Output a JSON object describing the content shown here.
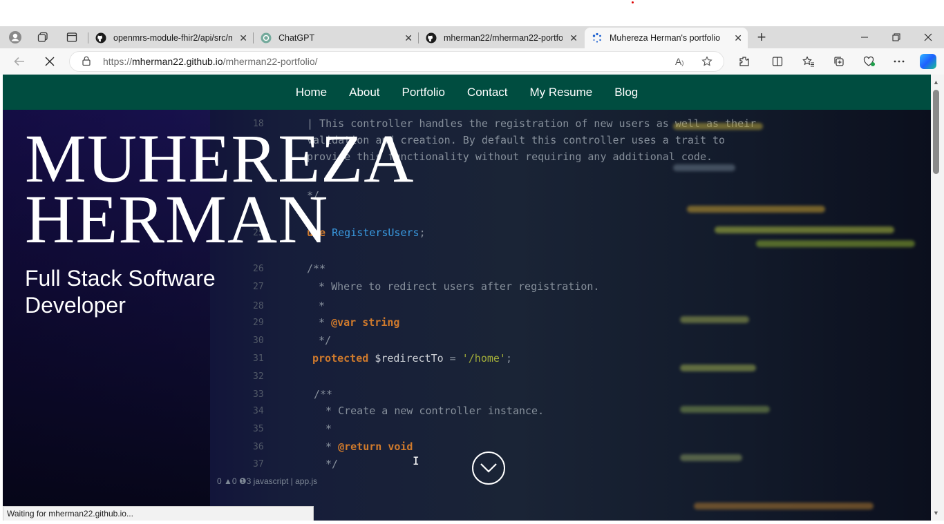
{
  "browser": {
    "tabs": [
      {
        "title": "openmrs-module-fhir2/api/src/m",
        "favicon": "github-icon",
        "active": false
      },
      {
        "title": "ChatGPT",
        "favicon": "chatgpt-icon",
        "active": false
      },
      {
        "title": "mherman22/mherman22-portfoli",
        "favicon": "github-icon",
        "active": false
      },
      {
        "title": "Muhereza Herman's portfolio",
        "favicon": "loading-spinner-icon",
        "active": true
      }
    ],
    "url_prefix": "https://",
    "url_host": "mherman22.github.io",
    "url_path": "/mherman22-portfolio/",
    "status_text": "Waiting for mherman22.github.io..."
  },
  "site": {
    "nav": [
      "Home",
      "About",
      "Portfolio",
      "Contact",
      "My Resume",
      "Blog"
    ],
    "name_line1": "MUHEREZA",
    "name_line2": "HERMAN",
    "tagline": "Full Stack Software Developer",
    "nav_color": "#004d40"
  },
  "code_bg": {
    "lines": [
      {
        "n": "18",
        "t": "| This controller handles the registration of new users as well as their"
      },
      {
        "n": "",
        "t": "validation and creation. By default this controller uses a trait to"
      },
      {
        "n": "",
        "t": "provide this functionality without requiring any additional code."
      },
      {
        "n": "",
        "t": "*/"
      },
      {
        "n": "25",
        "t": "use RegistersUsers;"
      },
      {
        "n": "26",
        "t": "/**"
      },
      {
        "n": "27",
        "t": " * Where to redirect users after registration."
      },
      {
        "n": "28",
        "t": " *"
      },
      {
        "n": "29",
        "t": " * @var string"
      },
      {
        "n": "30",
        "t": " */"
      },
      {
        "n": "31",
        "t": "protected $redirectTo = '/home';"
      },
      {
        "n": "32",
        "t": ""
      },
      {
        "n": "33",
        "t": "/**"
      },
      {
        "n": "34",
        "t": " * Create a new controller instance."
      },
      {
        "n": "35",
        "t": " *"
      },
      {
        "n": "36",
        "t": " * @return void"
      },
      {
        "n": "37",
        "t": " */"
      }
    ],
    "footer": "0 ▲0 ❶3   javascript | app.js"
  }
}
